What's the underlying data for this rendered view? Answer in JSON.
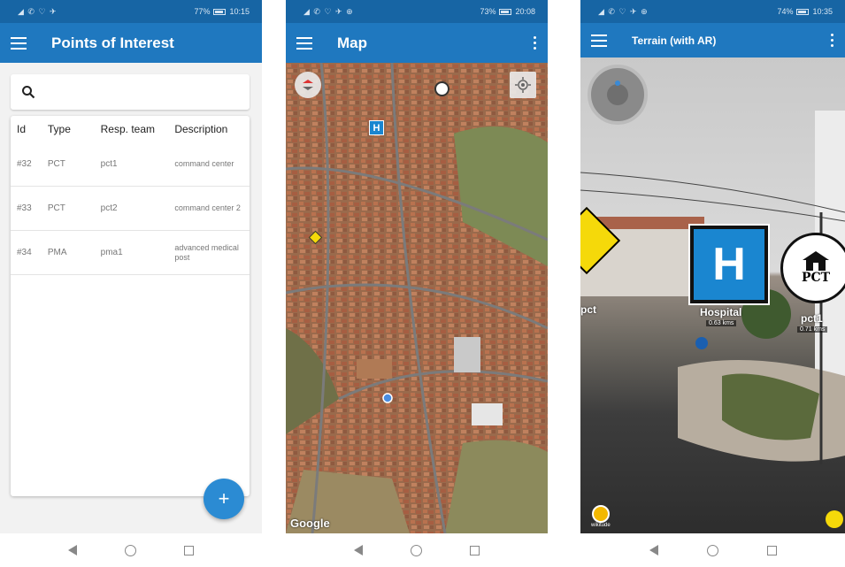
{
  "screens": {
    "list": {
      "status": {
        "time": "10:15",
        "battery": "77%",
        "icons": "◢ ✆ ♡ ✈"
      },
      "title": "Points of Interest",
      "search": {
        "placeholder": ""
      },
      "table": {
        "headers": [
          "Id",
          "Type",
          "Resp. team",
          "Description"
        ],
        "rows": [
          {
            "id": "#32",
            "type": "PCT",
            "team": "pct1",
            "desc": "command center"
          },
          {
            "id": "#33",
            "type": "PCT",
            "team": "pct2",
            "desc": "command center 2"
          },
          {
            "id": "#34",
            "type": "PMA",
            "team": "pma1",
            "desc": "advanced medical post"
          }
        ]
      },
      "fab_label": "+"
    },
    "map": {
      "status": {
        "time": "20:08",
        "battery": "73%",
        "icons": "◢ ✆ ♡ ✈ ⊕"
      },
      "title": "Map",
      "attribution": "Google",
      "hospital_marker": "H"
    },
    "ar": {
      "status": {
        "time": "10:35",
        "battery": "74%",
        "icons": "◢ ✆ ♡ ✈ ⊕"
      },
      "title": "Terrain (with AR)",
      "markers": [
        {
          "label": "Hospital",
          "distance": "0.63 kms",
          "symbol": "H"
        },
        {
          "label": "pct1",
          "distance": "0.71 kms",
          "symbol": "PCT"
        },
        {
          "label": "pct",
          "distance": "",
          "symbol": ""
        }
      ],
      "branding": "wikitude"
    }
  },
  "colors": {
    "appbar": "#1f78bf",
    "statusbar": "#1765a4",
    "fab": "#2b8bd3",
    "hospital": "#1a86d0"
  }
}
